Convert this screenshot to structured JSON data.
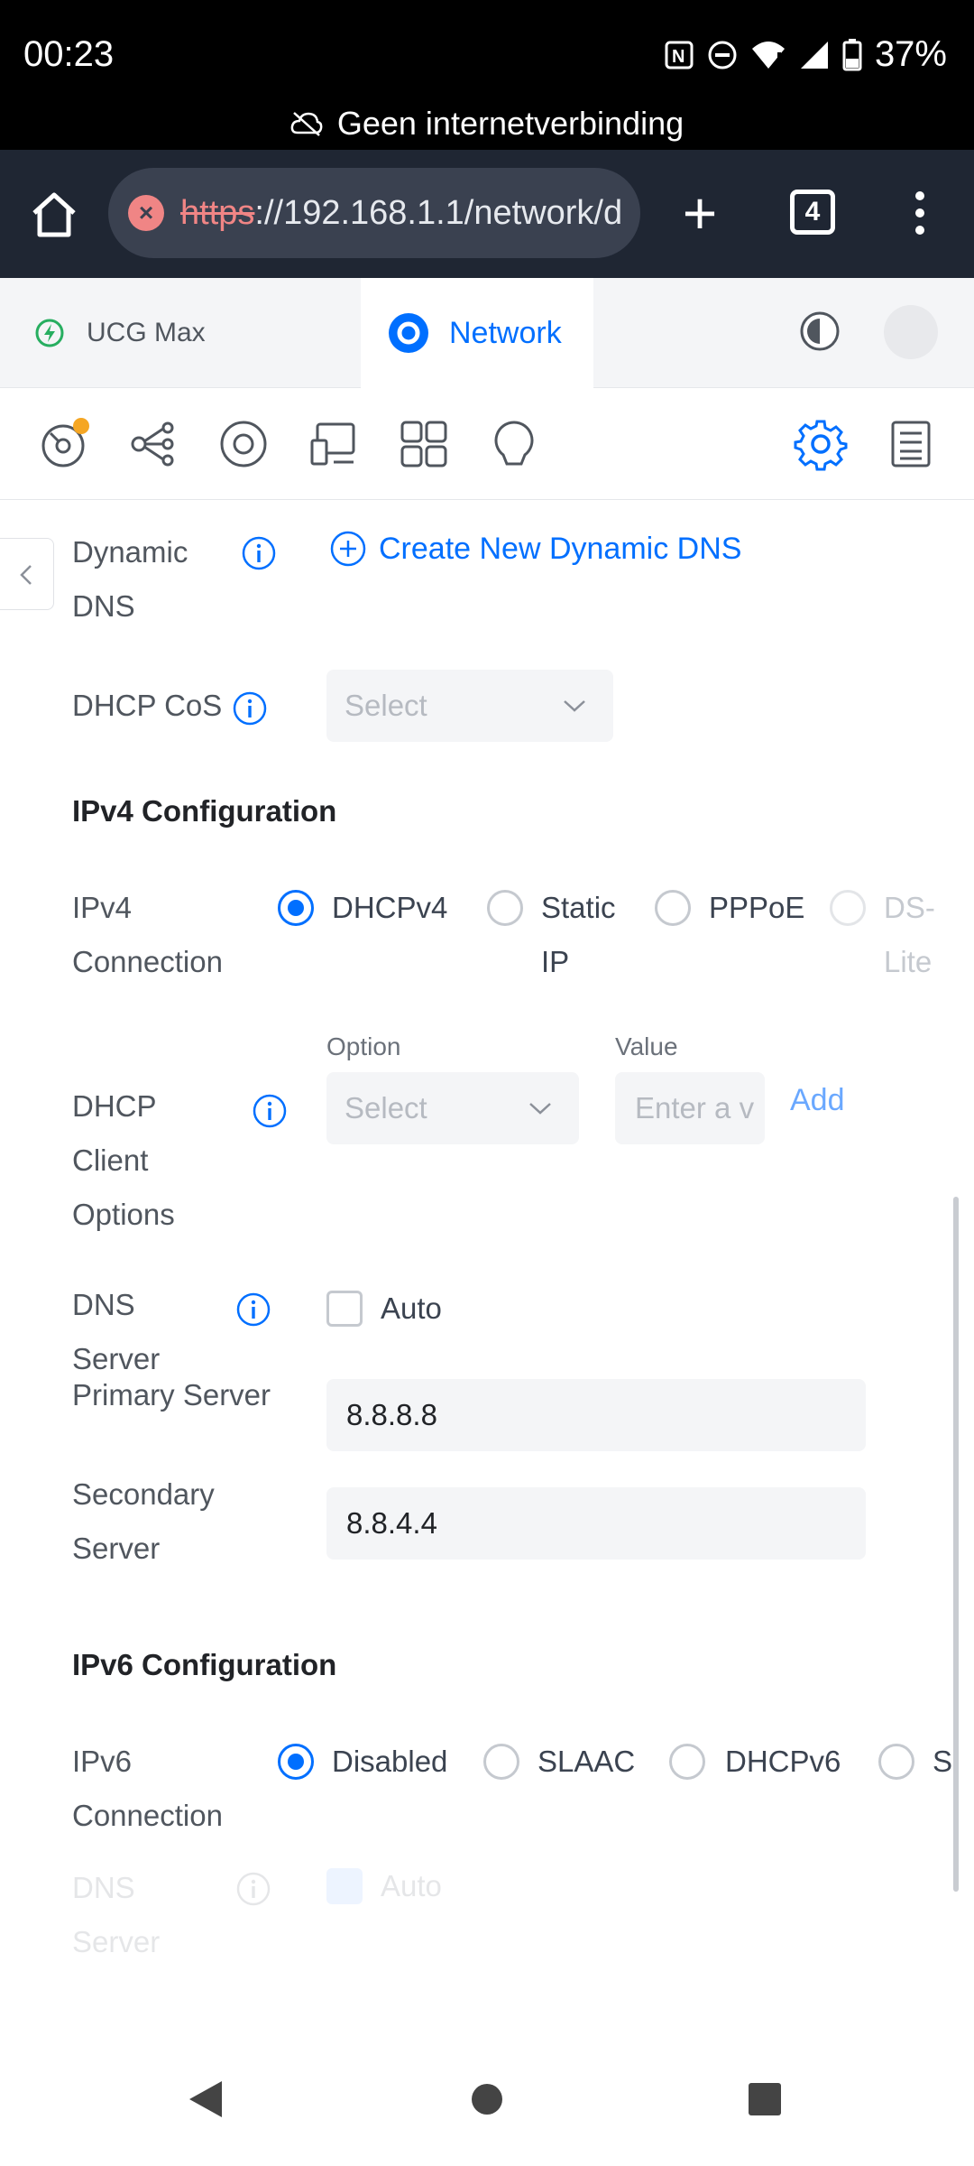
{
  "status_bar": {
    "time": "00:23",
    "battery": "37%",
    "icons": [
      "nfc-icon",
      "dnd-icon",
      "wifi-icon",
      "signal-icon",
      "battery-icon"
    ]
  },
  "connection_banner": "Geen internetverbinding",
  "browser": {
    "url_https": "https",
    "url_rest": "://192.168.1.1/network/d",
    "tab_count": "4"
  },
  "app_tabs": {
    "device": "UCG Max",
    "app": "Network"
  },
  "form": {
    "dynamic_dns": {
      "label_line1": "Dynamic",
      "label_line2": "DNS",
      "action": "Create New Dynamic DNS"
    },
    "dhcp_cos": {
      "label": "DHCP CoS",
      "placeholder": "Select"
    },
    "ipv4_title": "IPv4 Configuration",
    "ipv4_connection": {
      "label_line1": "IPv4",
      "label_line2": "Connection",
      "options": [
        {
          "label": "DHCPv4",
          "selected": true
        },
        {
          "label_line1": "Static",
          "label_line2": "IP",
          "selected": false
        },
        {
          "label": "PPPoE",
          "selected": false
        },
        {
          "label_line1": "DS-",
          "label_line2": "Lite",
          "selected": false,
          "disabled": true
        }
      ]
    },
    "dhcp_client_options": {
      "label_line1": "DHCP",
      "label_line2": "Client",
      "label_line3": "Options",
      "option_header": "Option",
      "value_header": "Value",
      "option_placeholder": "Select",
      "value_placeholder": "Enter a v",
      "add_label": "Add"
    },
    "dns_server": {
      "label_line1": "DNS",
      "label_line2": "Server",
      "auto_label": "Auto",
      "auto_checked": false
    },
    "primary_server": {
      "label": "Primary Server",
      "value": "8.8.8.8"
    },
    "secondary_server": {
      "label_line1": "Secondary",
      "label_line2": "Server",
      "value": "8.8.4.4"
    },
    "ipv6_title": "IPv6 Configuration",
    "ipv6_connection": {
      "label_line1": "IPv6",
      "label_line2": "Connection",
      "options": [
        {
          "label": "Disabled",
          "selected": true
        },
        {
          "label": "SLAAC",
          "selected": false
        },
        {
          "label": "DHCPv6",
          "selected": false
        },
        {
          "label": "S",
          "selected": false
        }
      ]
    },
    "ipv6_dns": {
      "label_line1": "DNS",
      "label_line2": "Server",
      "auto_label": "Auto"
    }
  },
  "colors": {
    "accent": "#006fff",
    "browser_bar": "#1f2633",
    "field_bg": "#f4f5f7",
    "notification_dot": "#f5a623"
  }
}
